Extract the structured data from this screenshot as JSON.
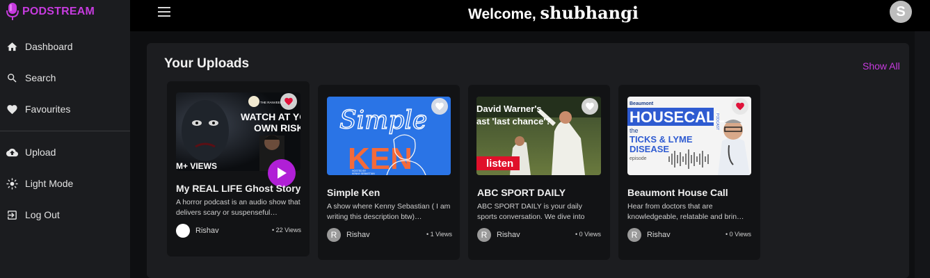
{
  "app": {
    "brand": "PODSTREAM"
  },
  "sidebar": {
    "items": [
      {
        "label": "Dashboard",
        "icon": "home-icon"
      },
      {
        "label": "Search",
        "icon": "search-icon"
      },
      {
        "label": "Favourites",
        "icon": "heart-icon"
      },
      {
        "label": "Upload",
        "icon": "cloud-upload-icon"
      },
      {
        "label": "Light Mode",
        "icon": "sun-icon"
      },
      {
        "label": "Log Out",
        "icon": "logout-icon"
      }
    ]
  },
  "header": {
    "welcome_prefix": "Welcome, ",
    "username": "shubhangi",
    "avatar_letter": "S"
  },
  "uploads": {
    "title": "Your Uploads",
    "show_all": "Show All",
    "cards": [
      {
        "title": "My REAL LIFE Ghost Story",
        "description": "A horror podcast is an audio show that delivers scary or suspenseful…",
        "author": "Rishav",
        "author_initial": "",
        "views": "• 22 Views",
        "favourited": true,
        "thumb_text": [
          "WATCH AT YOU",
          "OWN RISK.",
          "M+ VIEWS",
          "THE RANVEER SHOW"
        ]
      },
      {
        "title": "Simple Ken",
        "description": "A show where Kenny Sebastian ( I am writing this description btw)…",
        "author": "Rishav",
        "author_initial": "R",
        "views": "• 1 Views",
        "favourited": false,
        "thumb_text": [
          "Simple",
          "KEN",
          "HOSTED BY",
          "KENNY SEBASTIAN"
        ]
      },
      {
        "title": "ABC SPORT DAILY",
        "description": "ABC SPORT DAILY is your daily sports conversation. We dive into the…",
        "author": "Rishav",
        "author_initial": "R",
        "views": "• 0 Views",
        "favourited": false,
        "thumb_text": [
          "David Warner's",
          "ast 'last chance'?",
          "listen"
        ]
      },
      {
        "title": "Beaumont House Call",
        "description": "Hear from doctors that are knowledgeable, relatable and brin…",
        "author": "Rishav",
        "author_initial": "R",
        "views": "• 0 Views",
        "favourited": true,
        "thumb_text": [
          "Beaumont",
          "HOUSECALL",
          "PODCAST",
          "the",
          "TICKS & LYME",
          "DISEASE",
          "episode"
        ]
      }
    ]
  },
  "colors": {
    "accent": "#c63bde",
    "play": "#b01fd6",
    "heart_red": "#e0123a",
    "sidebar_bg": "#1b1c1f"
  }
}
